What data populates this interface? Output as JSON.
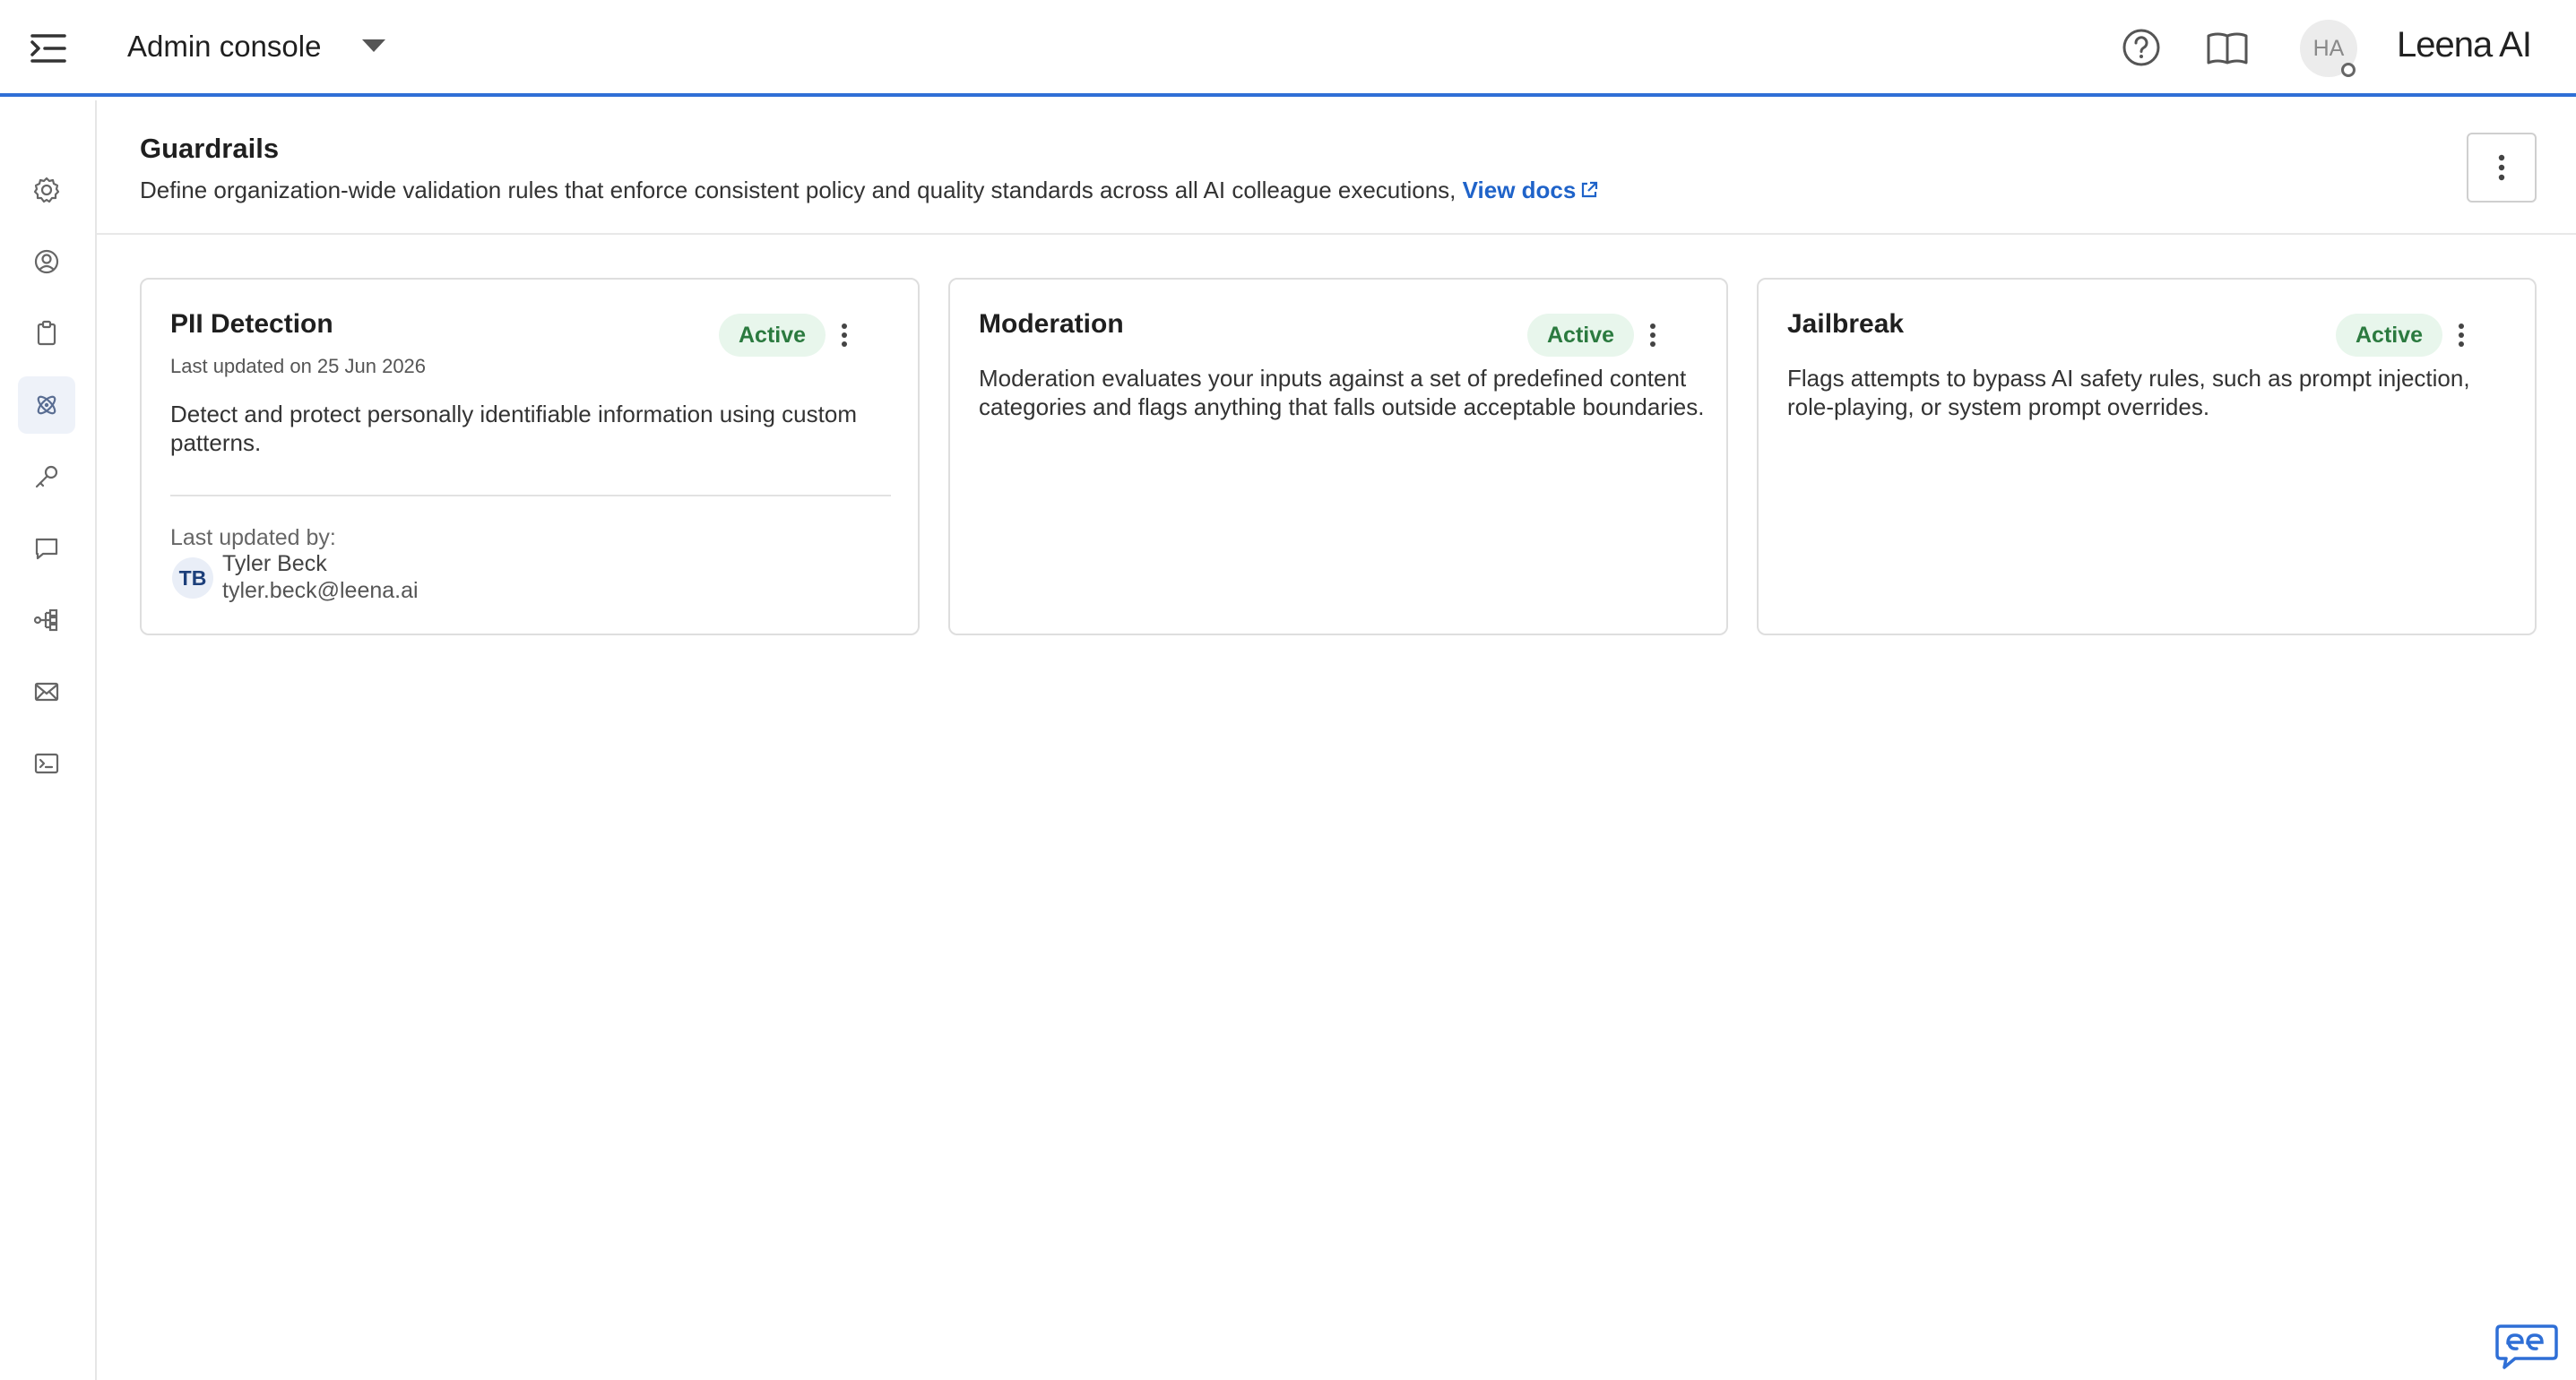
{
  "header": {
    "app_title": "Admin console",
    "avatar_initials": "HA",
    "brand": "Leena AI"
  },
  "colors": {
    "accent": "#2f6fd6",
    "link": "#1f63c9",
    "active_badge_bg": "#e8f6ec",
    "active_badge_text": "#2b7a3f"
  },
  "sidebar": {
    "items": [
      {
        "icon": "gear-icon",
        "active": false
      },
      {
        "icon": "user-circle-icon",
        "active": false
      },
      {
        "icon": "clipboard-icon",
        "active": false
      },
      {
        "icon": "guardrails-icon",
        "active": true
      },
      {
        "icon": "key-icon",
        "active": false
      },
      {
        "icon": "chat-icon",
        "active": false
      },
      {
        "icon": "workflow-icon",
        "active": false
      },
      {
        "icon": "mail-icon",
        "active": false
      },
      {
        "icon": "terminal-icon",
        "active": false
      }
    ]
  },
  "page": {
    "title": "Guardrails",
    "description": "Define organization-wide validation rules that enforce consistent policy and quality standards across all AI colleague executions,",
    "docs_link": "View docs"
  },
  "cards": [
    {
      "title": "PII Detection",
      "status": "Active",
      "last_updated": "Last updated on 25 Jun 2026",
      "description": "Detect and protect personally identifiable information using custom patterns.",
      "updated_by_label": "Last updated by:",
      "user_initials": "TB",
      "user_name": "Tyler Beck",
      "user_email": "tyler.beck@leena.ai"
    },
    {
      "title": "Moderation",
      "status": "Active",
      "description": "Moderation evaluates your inputs against a set of predefined content categories and flags anything that falls outside acceptable boundaries."
    },
    {
      "title": "Jailbreak",
      "status": "Active",
      "description": "Flags attempts to bypass AI safety rules, such as prompt injection, role-playing, or system prompt overrides."
    }
  ]
}
